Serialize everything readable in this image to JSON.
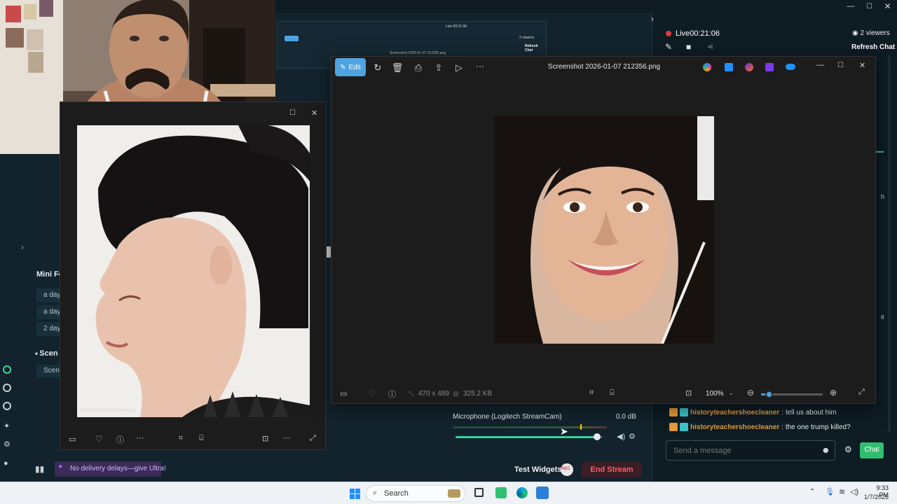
{
  "stream": {
    "live_label": "Live",
    "live_time": "00:21:06",
    "viewers": "2 viewers",
    "refresh_chat": "Refresh Chat",
    "mini_feed_title": "Mini Fe",
    "feed_items": [
      "a day",
      "a day",
      "2 day"
    ],
    "scenes_title": "Scen",
    "scene_item": "Scene",
    "promo": "No delivery delays—give Ultra!",
    "test_widgets": "Test Widgets",
    "end_stream": "End Stream",
    "mic_label": "Microphone (Logitech StreamCam)",
    "mic_db": "0.0 dB",
    "mic_level": 0.96,
    "peek_text_1": "h",
    "peek_text_2": "it",
    "rec_badge": "REC"
  },
  "viewer": {
    "edit_label": "Edit",
    "filename": "Screenshot 2026-01-07 212356.png",
    "dims": "470 x 489",
    "size": "325.2 KB",
    "zoom": "100%",
    "zoom_level": 0.12
  },
  "viewer2": {
    "watermark": "© Matt Baron/BEI/Shutterstock"
  },
  "mini_screen": {
    "live": "Live 00:21:06",
    "viewers": "2 viewers",
    "refresh": "Refresh Chat",
    "title": "Screenshot 2026-01-07 212356.png"
  },
  "chat": {
    "messages": [
      {
        "user": "historyteachershoecleaner",
        "text": ": tell us about him"
      },
      {
        "user": "historyteachershoecleaner",
        "text": ": the one trump killed?"
      }
    ],
    "placeholder": "Send a message",
    "send_label": "Chat"
  },
  "taskbar": {
    "search_placeholder": "Search",
    "time": "9:33 PM",
    "date": "1/7/2026"
  },
  "colors": {
    "accent": "#4fa3e0",
    "live_red": "#e0383b",
    "chat_green": "#2fbf71",
    "end_stream": "#e2505a",
    "username": "#e49b38",
    "promo_bg": "#3a2c57"
  }
}
